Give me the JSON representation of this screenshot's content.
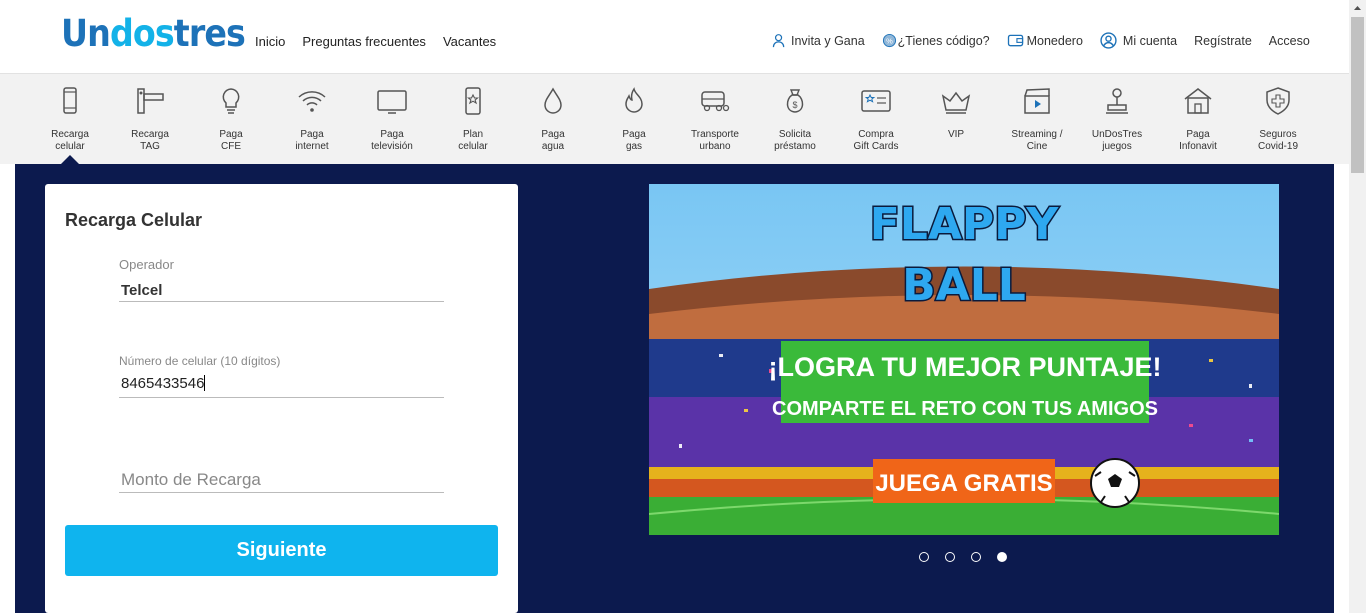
{
  "header": {
    "logo": {
      "part1": "Un",
      "part2": "dos",
      "part3": "tres"
    },
    "nav_left": [
      "Inicio",
      "Preguntas frecuentes",
      "Vacantes"
    ],
    "nav_right": {
      "invite": "Invita y Gana",
      "code": "¿Tienes código?",
      "wallet": "Monedero",
      "account": "Mi cuenta",
      "register": "Regístrate",
      "login": "Acceso"
    }
  },
  "services": [
    {
      "l1": "Recarga",
      "l2": "celular",
      "icon": "phone-icon"
    },
    {
      "l1": "Recarga",
      "l2": "TAG",
      "icon": "toll-tag-icon"
    },
    {
      "l1": "Paga",
      "l2": "CFE",
      "icon": "lightbulb-icon"
    },
    {
      "l1": "Paga",
      "l2": "internet",
      "icon": "wifi-icon"
    },
    {
      "l1": "Paga",
      "l2": "televisión",
      "icon": "tv-icon"
    },
    {
      "l1": "Plan",
      "l2": "celular",
      "icon": "phone-star-icon"
    },
    {
      "l1": "Paga",
      "l2": "agua",
      "icon": "water-drop-icon"
    },
    {
      "l1": "Paga",
      "l2": "gas",
      "icon": "flame-icon"
    },
    {
      "l1": "Transporte",
      "l2": "urbano",
      "icon": "transport-icon"
    },
    {
      "l1": "Solicita",
      "l2": "préstamo",
      "icon": "money-bag-icon"
    },
    {
      "l1": "Compra",
      "l2": "Gift Cards",
      "icon": "gift-card-icon"
    },
    {
      "l1": "VIP",
      "l2": "",
      "icon": "crown-icon"
    },
    {
      "l1": "Streaming /",
      "l2": "Cine",
      "icon": "clapperboard-icon"
    },
    {
      "l1": "UnDosTres",
      "l2": "juegos",
      "icon": "joystick-icon"
    },
    {
      "l1": "Paga",
      "l2": "Infonavit",
      "icon": "house-icon"
    },
    {
      "l1": "Seguros",
      "l2": "Covid-19",
      "icon": "shield-cross-icon"
    }
  ],
  "form": {
    "title": "Recarga Celular",
    "operator_label": "Operador",
    "operator_value": "Telcel",
    "phone_label": "Número de celular (10 dígitos)",
    "phone_value": "8465433546",
    "amount_placeholder": "Monto de Recarga",
    "submit_label": "Siguiente"
  },
  "banner": {
    "title_line1": "FLAPPY",
    "title_line2": "BALL",
    "headline": "¡LOGRA TU MEJOR PUNTAJE!",
    "subline": "COMPARTE EL RETO CON TUS AMIGOS",
    "cta": "JUEGA GRATIS"
  },
  "carousel": {
    "count": 4,
    "active_index": 3
  },
  "colors": {
    "brand_dark": "#1d72b8",
    "brand_light": "#13b2e8",
    "main_bg": "#0c1a4e",
    "button": "#0fb4ee"
  }
}
